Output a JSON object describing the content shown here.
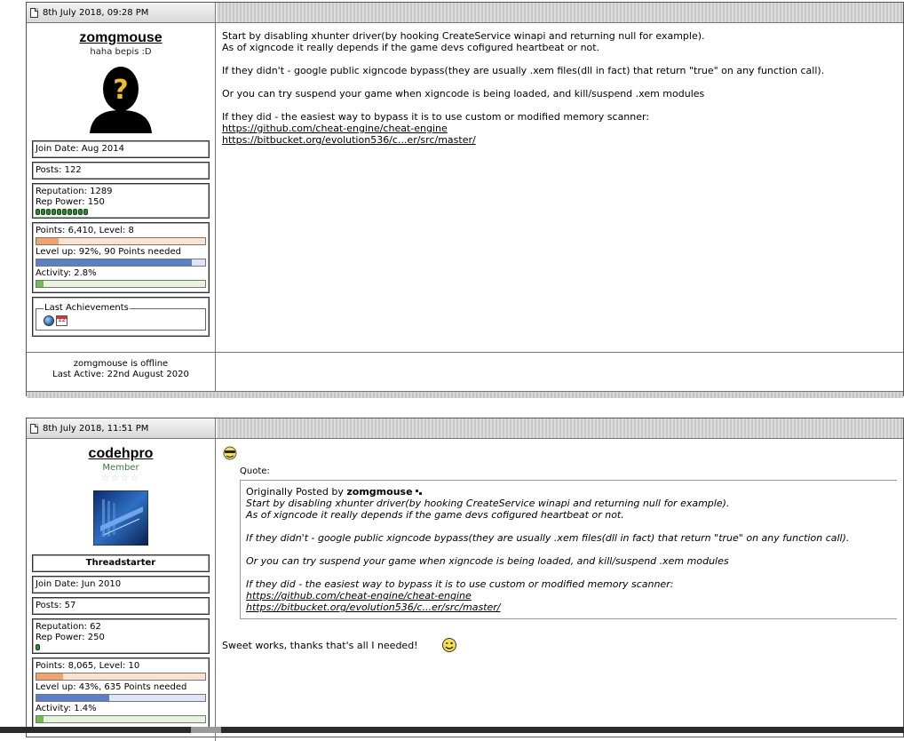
{
  "posts": [
    {
      "date": "8th July 2018, 09:28 PM",
      "username": "zomgmouse",
      "usertitle": "haha bepis :D",
      "join_date": "Join Date: Aug 2014",
      "posts": "Posts: 122",
      "reputation": "Reputation: 1289",
      "rep_power": "Rep Power: 150",
      "rep_pips": 10,
      "points_level": "Points: 6,410, Level: 8",
      "points_fraction": 0.13,
      "level_up": "Level up: 92%, 90 Points needed",
      "level_fraction": 0.92,
      "activity": "Activity: 2.8%",
      "activity_fraction": 0.04,
      "achievements_label": "Last Achievements",
      "achievement_cal": "12",
      "status": "zomgmouse is offline",
      "last_active": "Last Active: 22nd August 2020",
      "message": {
        "line1": "Start by disabling xhunter driver(by hooking CreateService winapi and returning null for example).",
        "line2": "As of xigncode it really depends if the game devs cofigured heartbeat or not.",
        "line3": "If they didn't - google public xigncode bypass(they are usually .xem files(dll in fact) that return \"true\" on any function call).",
        "line4": "Or you can try suspend your game when xigncode is being loaded, and kill/suspend .xem modules",
        "line5": "If they did - the easiest way to bypass it is to use custom or modified memory scanner:",
        "link1": "https://github.com/cheat-engine/cheat-engine",
        "link2": "https://bitbucket.org/evolution536/c...er/src/master/"
      }
    },
    {
      "date": "8th July 2018, 11:51 PM",
      "username": "codehpro",
      "usertitle": "Member",
      "stars": "☆☆☆☆",
      "threadstarter": "Threadstarter",
      "join_date": "Join Date: Jun 2010",
      "posts": "Posts: 57",
      "reputation": "Reputation: 62",
      "rep_power": "Rep Power: 250",
      "rep_pips": 1,
      "points_level": "Points: 8,065, Level: 10",
      "points_fraction": 0.16,
      "level_up": "Level up: 43%, 635 Points needed",
      "level_fraction": 0.43,
      "activity": "Activity: 1.4%",
      "activity_fraction": 0.04,
      "quote_label": "Quote:",
      "quote_prefix": "Originally Posted by",
      "quote_author": "zomgmouse",
      "reply": "Sweet works, thanks that's all I needed!"
    }
  ],
  "colors": {
    "points_fill": "#f4a26a",
    "level_fill": "#5b7fc8",
    "activity_fill": "#6cbf4a",
    "member_title": "#2e7d32"
  }
}
